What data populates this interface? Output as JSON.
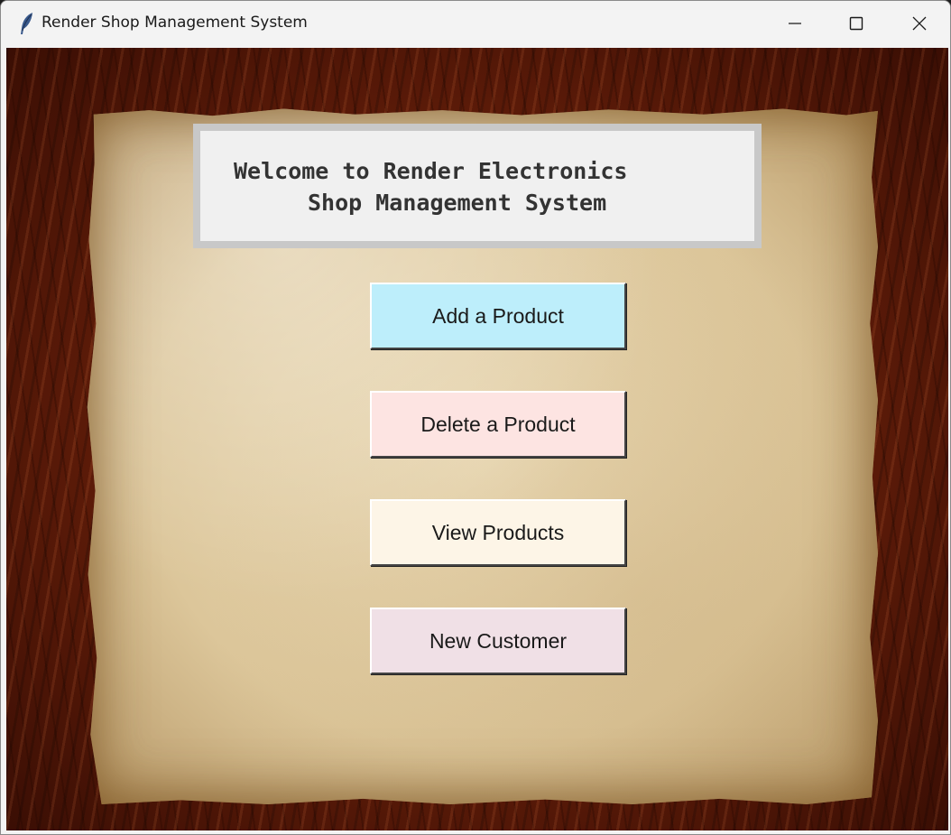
{
  "window": {
    "title": "Render Shop Management System",
    "app_icon": "feather-icon",
    "controls": [
      "minimize-icon",
      "maximize-icon",
      "close-icon"
    ]
  },
  "header": {
    "line1": "Welcome to Render Electronics",
    "line2": "Shop Management System"
  },
  "menu": {
    "add_product": {
      "label": "Add a Product",
      "color": "#bdeefb"
    },
    "delete_product": {
      "label": "Delete a Product",
      "color": "#fde4e2"
    },
    "view_products": {
      "label": "View Products",
      "color": "#fdf5e7"
    },
    "new_customer": {
      "label": "New Customer",
      "color": "#f0e0e6"
    }
  },
  "colors": {
    "wood": "#5a1a08",
    "parchment": "#e6d3ab",
    "header_bg": "#f0f0f0",
    "header_border": "#c8c8c8"
  }
}
